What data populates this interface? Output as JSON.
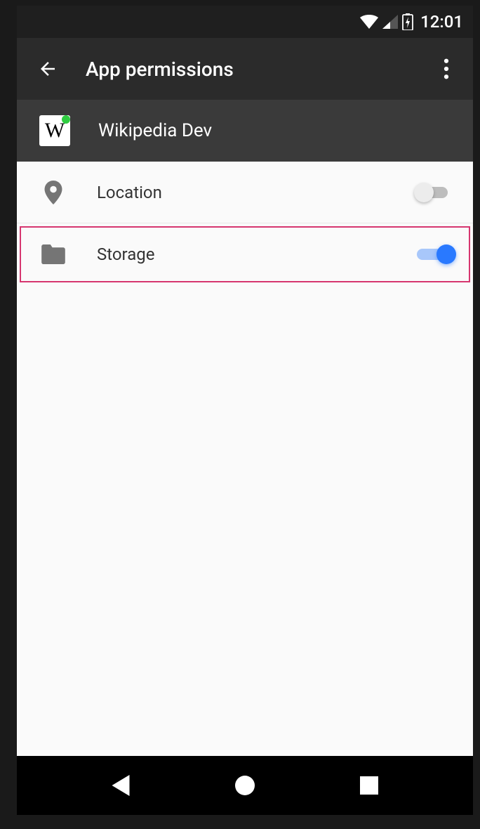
{
  "status": {
    "time": "12:01"
  },
  "app_bar": {
    "title": "App permissions"
  },
  "app": {
    "name": "Wikipedia Dev",
    "icon_letter": "W"
  },
  "permissions": [
    {
      "label": "Location",
      "enabled": false,
      "icon": "location",
      "highlight": false
    },
    {
      "label": "Storage",
      "enabled": true,
      "icon": "folder",
      "highlight": true
    }
  ]
}
